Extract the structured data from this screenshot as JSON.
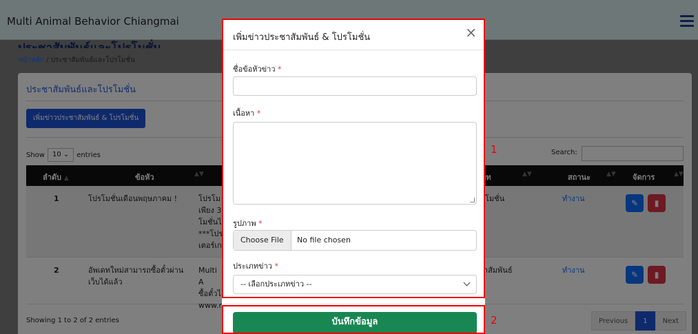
{
  "app": {
    "brand": "Multi Animal Behavior Chiangmai"
  },
  "page": {
    "title": "ประชาสัมพันธ์และโปรโมชั่น",
    "breadcrumb_home": "หน้าหลัก",
    "breadcrumb_current": "ประชาสัมพันธ์และโปรโมชั่น"
  },
  "card": {
    "title": "ประชาสัมพันธ์และโปรโมชั่น",
    "add_button": "เพิ่มข่าวประชาสัมพันธ์ & โปรโมชั่น",
    "show_label": "Show",
    "entries_value": "10",
    "entries_label": "entries",
    "search_label": "Search:"
  },
  "table": {
    "headers": {
      "no": "ลำดับ",
      "topic": "ข้อหัว",
      "type": "ภท",
      "status": "สถานะ",
      "manage": "จัดการ"
    },
    "rows": [
      {
        "no": "1",
        "topic": "โปรโมชั่นเดือนพฤษภาคม !",
        "content_lines": [
          "โปรโม",
          "เพียง 3",
          "โมชั่นไ",
          "***โปร",
          "เตอร์เก"
        ],
        "type": "โมชั่น",
        "status": "ทำงาน"
      },
      {
        "no": "2",
        "topic_lines": [
          "อัพเดทใหม่สามารถซื้อตั๋วผ่าน",
          "เว็บได้แล้ว"
        ],
        "content_lines": [
          "Multi A",
          "ซื้อตั๋วไ",
          "www.r"
        ],
        "type": "ะาสัมพันธ์",
        "status": "ทำงาน"
      }
    ],
    "showing": "Showing 1 to 2 of 2 entries",
    "pager": {
      "previous": "Previous",
      "page": "1",
      "next": "Next"
    }
  },
  "modal": {
    "title": "เพิ่มข่าวประชาสัมพันธ์ & โปรโมชั่น",
    "close": "×",
    "required_mark": "*",
    "fields": {
      "headline_label": "ชื่อข้อหัวข่าว",
      "headline_value": "",
      "content_label": "เนื้อหา",
      "content_value": "",
      "image_label": "รูปภาพ",
      "file_button": "Choose File",
      "file_status": "No file chosen",
      "type_label": "ประเภทข่าว",
      "type_selected": "-- เลือกประเภทข่าว --"
    },
    "save_button": "บันทึกข้อมูล"
  },
  "annotations": {
    "highlight_color": "#ee0000",
    "label_1": "1",
    "label_2": "2"
  }
}
